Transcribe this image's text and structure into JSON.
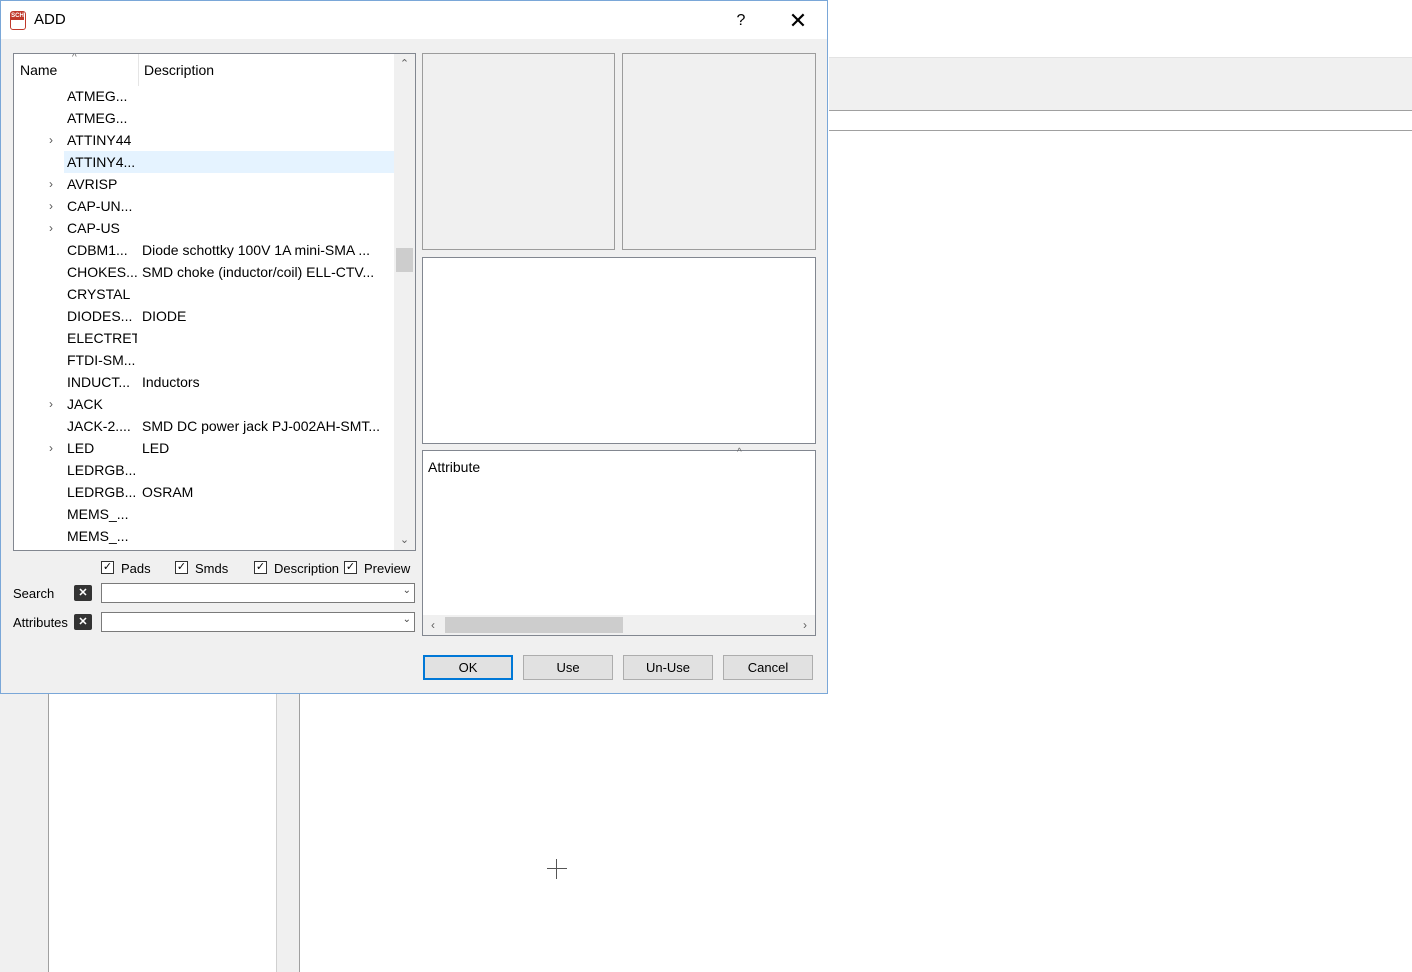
{
  "dialog": {
    "title": "ADD",
    "icon_label": "SCH",
    "help": "?",
    "close": "✕"
  },
  "tree": {
    "columns": {
      "name": "Name",
      "description": "Description"
    },
    "rows": [
      {
        "name": "ATMEG...",
        "description": "",
        "expandable": false
      },
      {
        "name": "ATMEG...",
        "description": "",
        "expandable": false
      },
      {
        "name": "ATTINY44",
        "description": "",
        "expandable": true
      },
      {
        "name": "ATTINY4...",
        "description": "",
        "expandable": false,
        "selected": true
      },
      {
        "name": "AVRISP",
        "description": "",
        "expandable": true
      },
      {
        "name": "CAP-UN...",
        "description": "",
        "expandable": true
      },
      {
        "name": "CAP-US",
        "description": "",
        "expandable": true
      },
      {
        "name": "CDBM1...",
        "description": "Diode schottky 100V 1A mini-SMA ...",
        "expandable": false
      },
      {
        "name": "CHOKES...",
        "description": "SMD choke (inductor/coil) ELL-CTV...",
        "expandable": false
      },
      {
        "name": "CRYSTAL",
        "description": "",
        "expandable": false
      },
      {
        "name": "DIODES...",
        "description": "DIODE",
        "expandable": false
      },
      {
        "name": "ELECTRET",
        "description": "",
        "expandable": false
      },
      {
        "name": "FTDI-SM...",
        "description": "",
        "expandable": false
      },
      {
        "name": "INDUCT...",
        "description": "Inductors",
        "expandable": false
      },
      {
        "name": "JACK",
        "description": "",
        "expandable": true
      },
      {
        "name": "JACK-2....",
        "description": "SMD DC power jack PJ-002AH-SMT...",
        "expandable": false
      },
      {
        "name": "LED",
        "description": "LED",
        "expandable": true
      },
      {
        "name": "LEDRGB...",
        "description": "",
        "expandable": false
      },
      {
        "name": "LEDRGB...",
        "description": "OSRAM",
        "expandable": false
      },
      {
        "name": "MEMS_...",
        "description": "",
        "expandable": false
      },
      {
        "name": "MEMS_...",
        "description": "",
        "expandable": false
      }
    ]
  },
  "options": {
    "pads": "Pads",
    "smds": "Smds",
    "description": "Description",
    "preview": "Preview"
  },
  "search": {
    "label": "Search",
    "value": ""
  },
  "attributes": {
    "label": "Attributes",
    "value": ""
  },
  "attr_pane": {
    "header": "Attribute"
  },
  "buttons": {
    "ok": "OK",
    "use": "Use",
    "unuse": "Un-Use",
    "cancel": "Cancel"
  },
  "icons": {
    "expand": "›",
    "up": "⌃",
    "down": "⌄",
    "left": "‹",
    "right": "›",
    "check": "✓",
    "clear": "✕",
    "combo_arrow": "⌄",
    "sort": "^"
  }
}
